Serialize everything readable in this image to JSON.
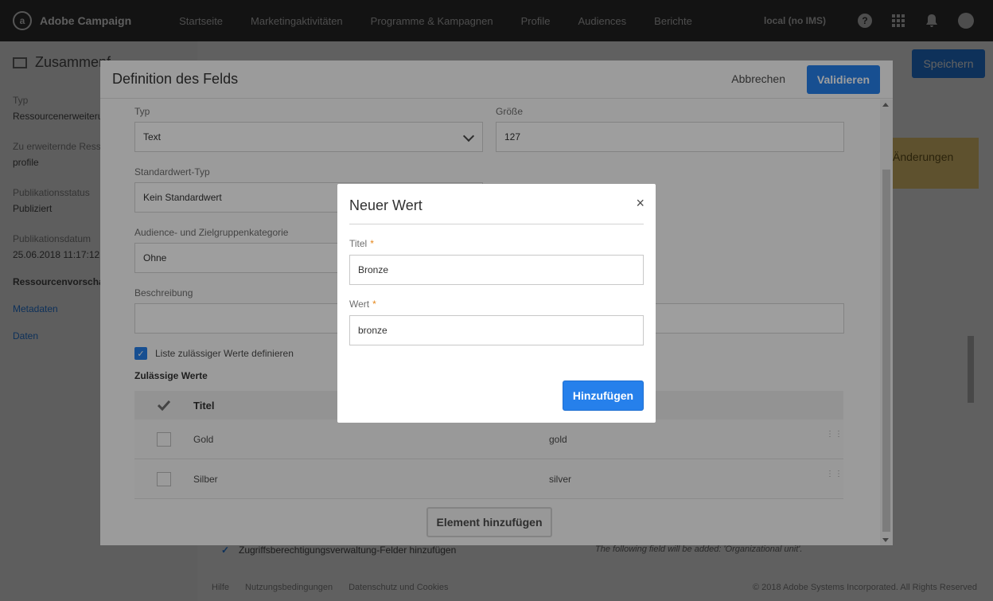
{
  "topbar": {
    "app_name": "Adobe Campaign",
    "nav": [
      "Startseite",
      "Marketingaktivitäten",
      "Programme & Kampagnen",
      "Profile",
      "Audiences",
      "Berichte"
    ],
    "tenant": "local (no IMS)"
  },
  "sidebar": {
    "title": "Zusammenf",
    "fields": [
      {
        "label": "Typ",
        "value": "Ressourcenerweiterung"
      },
      {
        "label": "Zu erweiternde Ressource",
        "value": "profile"
      },
      {
        "label": "Publikationsstatus",
        "value": "Publiziert"
      },
      {
        "label": "Publikationsdatum",
        "value": "25.06.2018 11:17:12"
      }
    ],
    "preview": "Ressourcenvorschau",
    "links": [
      "Metadaten",
      "Daten"
    ]
  },
  "background": {
    "save_label": "Speichern",
    "changes_text": "Änderungen",
    "access_checkbox_label": "Zugriffsberechtigungsverwaltung-Felder hinzufügen",
    "note": "The following field will be added: 'Organizational unit'.",
    "footer_links": [
      "Hilfe",
      "Nutzungsbedingungen",
      "Datenschutz und Cookies"
    ],
    "copyright": "© 2018 Adobe Systems Incorporated. All Rights Reserved"
  },
  "field_dialog": {
    "title": "Definition des Felds",
    "cancel_label": "Abbrechen",
    "validate_label": "Validieren",
    "type_label": "Typ",
    "type_value": "Text",
    "size_label": "Größe",
    "size_value": "127",
    "default_type_label": "Standardwert-Typ",
    "default_type_value": "Kein Standardwert",
    "audience_label": "Audience- und Zielgruppenkategorie",
    "audience_value": "Ohne",
    "description_label": "Beschreibung",
    "description_value": "",
    "define_list_label": "Liste zulässiger Werte definieren",
    "allowed_values_title": "Zulässige Werte",
    "table_header_title": "Titel",
    "rows": [
      {
        "title": "Gold",
        "value": "gold"
      },
      {
        "title": "Silber",
        "value": "silver"
      }
    ],
    "add_element_label": "Element hinzufügen"
  },
  "new_value_modal": {
    "title": "Neuer Wert",
    "close_glyph": "×",
    "title_label": "Titel",
    "title_value": "Bronze",
    "value_label": "Wert",
    "value_value": "bronze",
    "required_mark": "*",
    "add_label": "Hinzufügen"
  },
  "colors": {
    "accent": "#2680eb",
    "topbar": "#323232",
    "required": "#e68619",
    "changes_banner": "#f5d57a"
  }
}
